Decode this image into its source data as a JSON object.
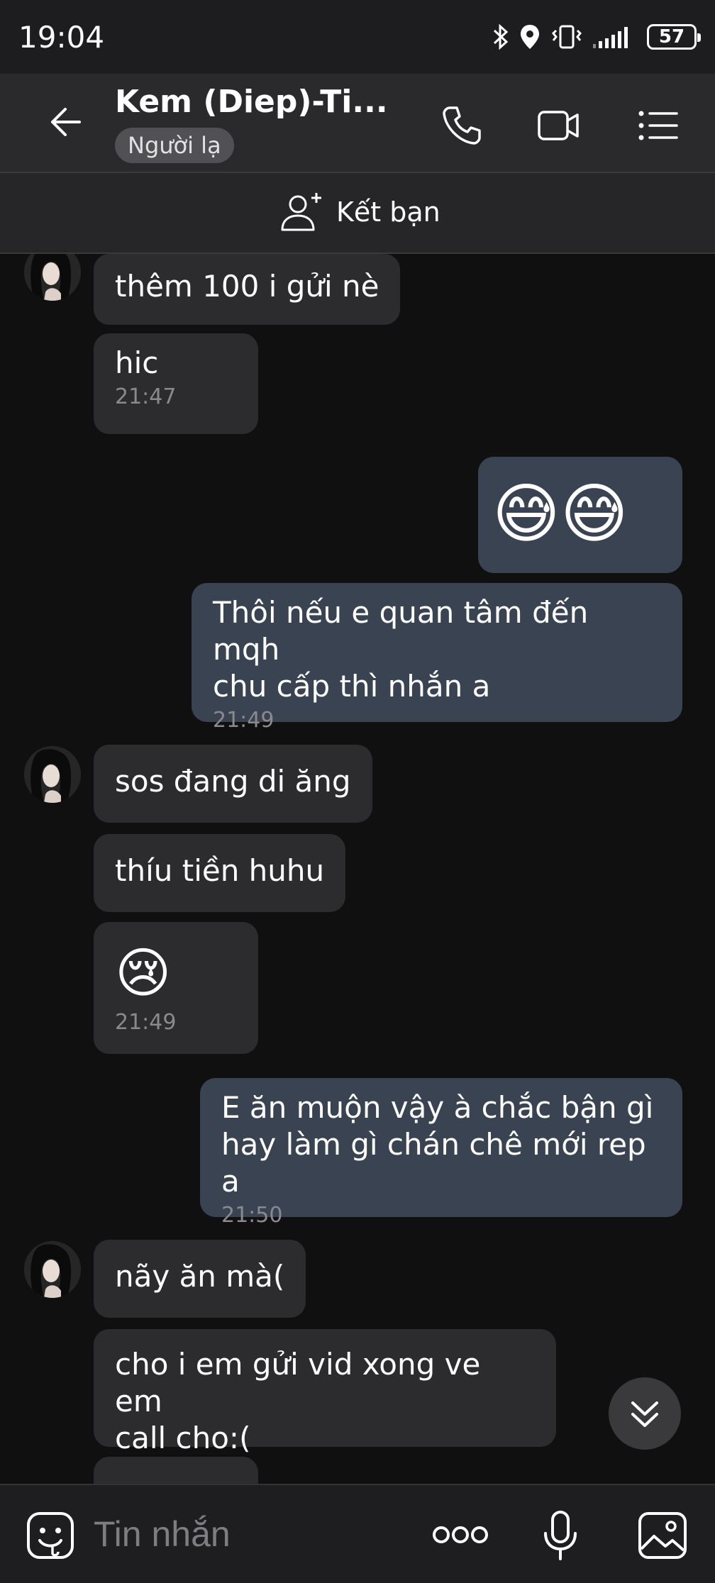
{
  "status_bar": {
    "time": "19:04",
    "battery": "57"
  },
  "header": {
    "contact_name": "Kem (Diep)-Ti...",
    "stranger_badge": "Người lạ",
    "icons": [
      "back-arrow-icon",
      "phone-icon",
      "video-call-icon",
      "menu-icon"
    ]
  },
  "add_friend": {
    "label": "Kết bạn"
  },
  "messages": [
    {
      "dir": "in",
      "text": "thêm 100 i gửi nè"
    },
    {
      "dir": "in",
      "text": "hic",
      "time": "21:47"
    },
    {
      "dir": "out",
      "emoji": "😅😅"
    },
    {
      "dir": "out",
      "line1": "Thôi nếu e quan tâm đến mqh",
      "line2": "chu cấp thì nhắn a",
      "time": "21:49"
    },
    {
      "dir": "in",
      "text": "sos đang di ăng"
    },
    {
      "dir": "in",
      "text": "thíu tiền huhu"
    },
    {
      "dir": "in",
      "emoji": "😢",
      "time": "21:49"
    },
    {
      "dir": "out",
      "line1": "E ăn muộn vậy à chắc bận gì",
      "line2": "hay làm gì chán chê mới rep a",
      "time": "21:50"
    },
    {
      "dir": "in",
      "text": "nãy ăn mà("
    },
    {
      "dir": "in",
      "line1": "cho i em gửi vid xong ve em",
      "line2": "call cho:("
    }
  ],
  "input": {
    "placeholder": "Tin nhắn"
  },
  "colors": {
    "incoming_bubble": "#2c2c2e",
    "outgoing_bubble": "#3a4352",
    "background": "#101010"
  }
}
